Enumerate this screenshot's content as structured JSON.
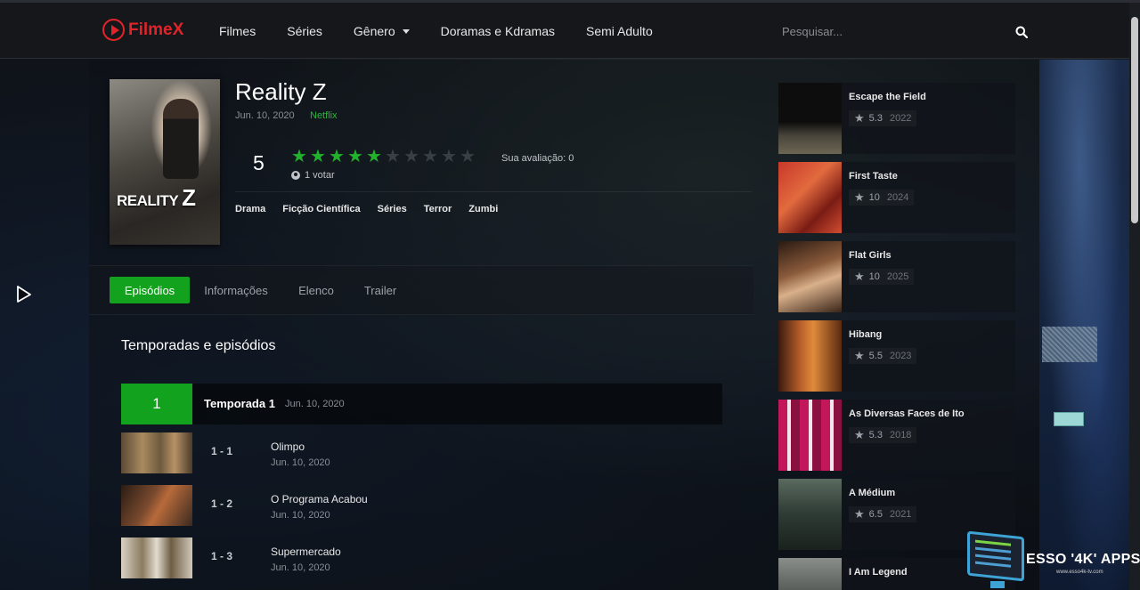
{
  "header": {
    "logo": "FilmeX",
    "nav": [
      {
        "label": "Filmes"
      },
      {
        "label": "Séries"
      },
      {
        "label": "Gênero"
      },
      {
        "label": "Doramas e Kdramas"
      },
      {
        "label": "Semi Adulto"
      }
    ],
    "search_placeholder": "Pesquisar..."
  },
  "show": {
    "poster_title": "REALITY",
    "poster_title_z": "Z",
    "title": "Reality Z",
    "date": "Jun. 10, 2020",
    "network": "Netflix",
    "score": "5",
    "stars_filled": 5,
    "stars_total": 10,
    "votes": "1 votar",
    "your_rating": "Sua avaliação: 0",
    "genres": [
      "Drama",
      "Ficção Científica",
      "Séries",
      "Terror",
      "Zumbi"
    ]
  },
  "tabs": [
    "Episódios",
    "Informações",
    "Elenco",
    "Trailer"
  ],
  "episodes_section": {
    "title": "Temporadas e episódios",
    "season": {
      "number": "1",
      "label": "Temporada 1",
      "date": "Jun. 10, 2020"
    },
    "episodes": [
      {
        "num": "1 - 1",
        "title": "Olimpo",
        "date": "Jun. 10, 2020"
      },
      {
        "num": "1 - 2",
        "title": "O Programa Acabou",
        "date": "Jun. 10, 2020"
      },
      {
        "num": "1 - 3",
        "title": "Supermercado",
        "date": "Jun. 10, 2020"
      }
    ]
  },
  "sidebar": [
    {
      "title": "Escape the Field",
      "rating": "5.3",
      "year": "2022"
    },
    {
      "title": "First Taste",
      "rating": "10",
      "year": "2024"
    },
    {
      "title": "Flat Girls",
      "rating": "10",
      "year": "2025"
    },
    {
      "title": "Hibang",
      "rating": "5.5",
      "year": "2023"
    },
    {
      "title": "As Diversas Faces de Ito",
      "rating": "5.3",
      "year": "2018"
    },
    {
      "title": "A Médium",
      "rating": "6.5",
      "year": "2021"
    },
    {
      "title": "I Am Legend",
      "rating": "",
      "year": ""
    }
  ],
  "watermark": {
    "text": "ESSO '4K' APPS",
    "sub": "www.esso4k-tv.com"
  },
  "colors": {
    "accent": "#12a21e",
    "brand": "#e0242a"
  }
}
